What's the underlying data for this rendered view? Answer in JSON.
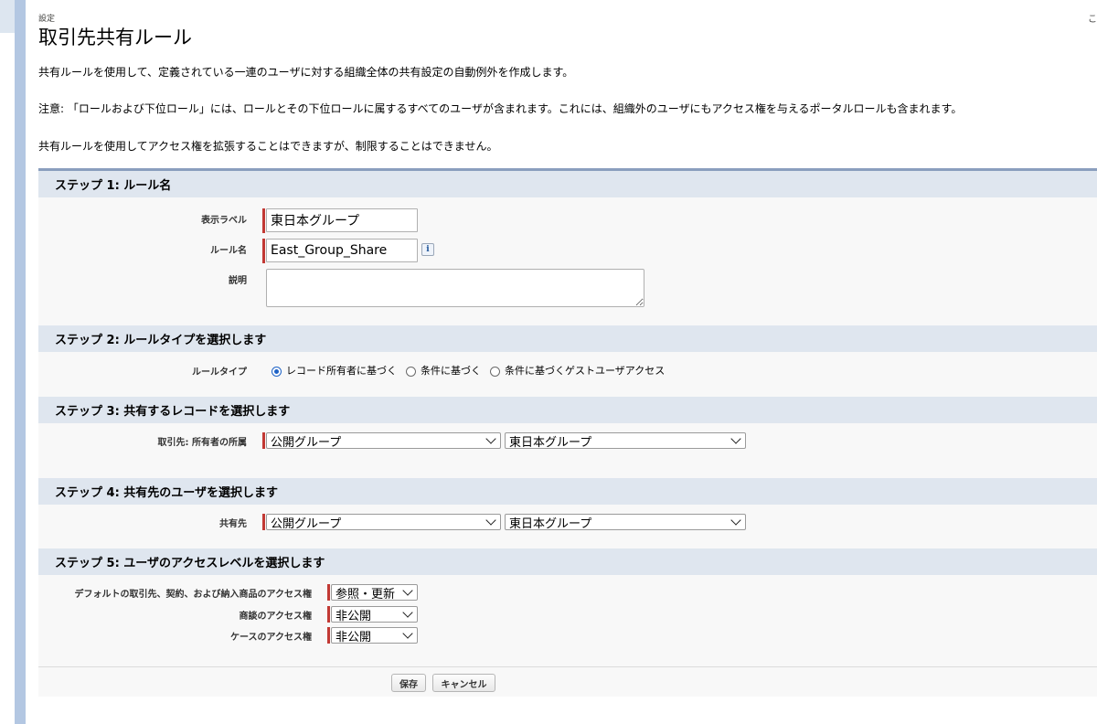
{
  "header": {
    "breadcrumb": "設定",
    "title": "取引先共有ルール",
    "corner_char": "こ"
  },
  "intro": {
    "line1": "共有ルールを使用して、定義されている一連のユーザに対する組織全体の共有設定の自動例外を作成します。",
    "line2": "注意: 「ロールおよび下位ロール」には、ロールとその下位ロールに属するすべてのユーザが含まれます。これには、組織外のユーザにもアクセス権を与えるポータルロールも含まれます。",
    "line3": "共有ルールを使用してアクセス権を拡張することはできますが、制限することはできません。"
  },
  "step1": {
    "header": "ステップ 1: ルール名",
    "label_field_label": "表示ラベル",
    "label_value": "東日本グループ",
    "name_field_label": "ルール名",
    "name_value": "East_Group_Share",
    "info_icon": "i",
    "desc_field_label": "説明",
    "desc_value": ""
  },
  "step2": {
    "header": "ステップ 2: ルールタイプを選択します",
    "field_label": "ルールタイプ",
    "options": [
      "レコード所有者に基づく",
      "条件に基づく",
      "条件に基づくゲストユーザアクセス"
    ],
    "selected_index": 0
  },
  "step3": {
    "header": "ステップ 3: 共有するレコードを選択します",
    "field_label": "取引先: 所有者の所属",
    "type_select": "公開グループ",
    "group_select": "東日本グループ"
  },
  "step4": {
    "header": "ステップ 4: 共有先のユーザを選択します",
    "field_label": "共有先",
    "type_select": "公開グループ",
    "group_select": "東日本グループ"
  },
  "step5": {
    "header": "ステップ 5: ユーザのアクセスレベルを選択します",
    "default_label": "デフォルトの取引先、契約、および納入商品のアクセス権",
    "default_value": "参照・更新",
    "opportunity_label": "商談のアクセス権",
    "opportunity_value": "非公開",
    "case_label": "ケースのアクセス権",
    "case_value": "非公開"
  },
  "buttons": {
    "save": "保存",
    "cancel": "キャンセル"
  },
  "colors": {
    "required_bar": "#c23934",
    "step_header_bg": "#dfe6ef",
    "left_bar": "#b3c7e2"
  }
}
